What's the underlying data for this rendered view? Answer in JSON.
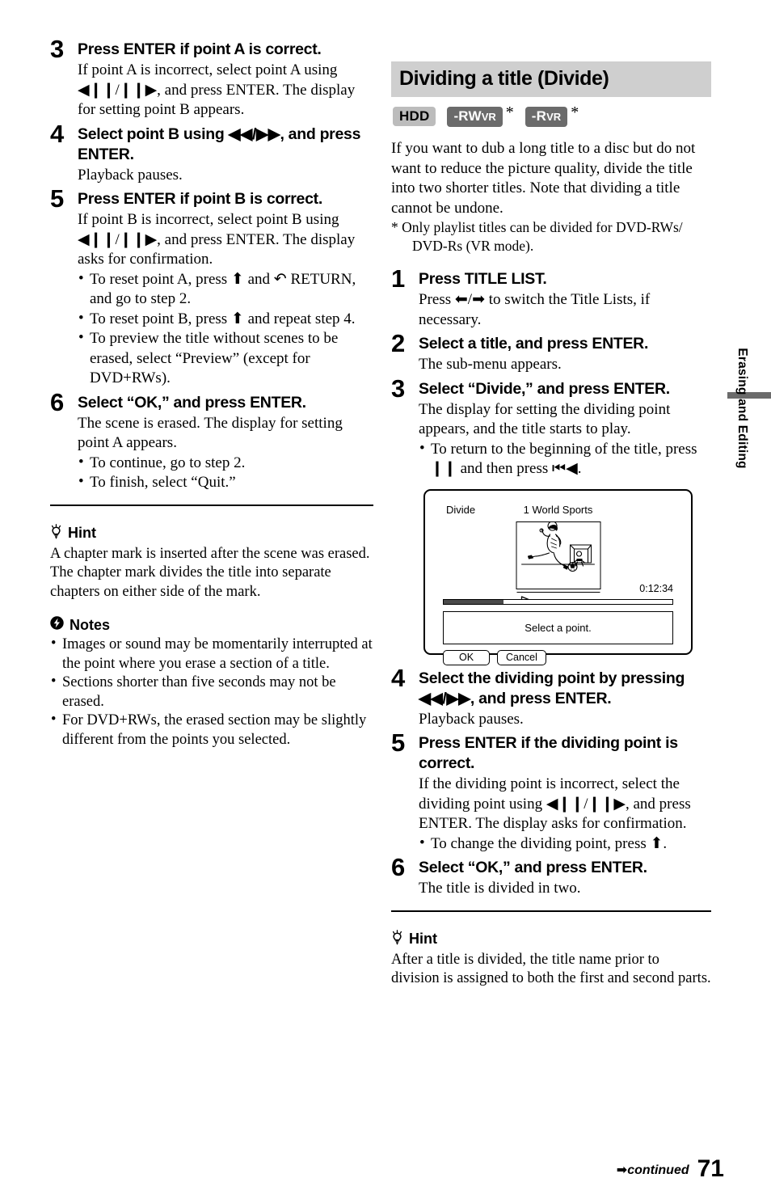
{
  "page": {
    "number": "71",
    "continued_label": "continued",
    "continued_arrow": "➡",
    "side_tab_label": "Erasing and Editing"
  },
  "left_column": {
    "steps": [
      {
        "num": "3",
        "title": "Press ENTER if point A is correct.",
        "text": "If point A is incorrect, select point A using ◀❙❙/❙❙▶, and press ENTER. The display for setting point B appears.",
        "bullets": []
      },
      {
        "num": "4",
        "title": "Select point B using ◀◀/▶▶, and press ENTER.",
        "text": "Playback pauses.",
        "bullets": []
      },
      {
        "num": "5",
        "title": "Press ENTER if point B is correct.",
        "text": "If point B is incorrect, select point B using ◀❙❙/❙❙▶, and press ENTER. The display asks for confirmation.",
        "bullets": [
          "To reset point A, press ⬆ and ↶ RETURN, and go to step 2.",
          "To reset point B, press ⬆ and repeat step 4.",
          "To preview the title without scenes to be erased, select “Preview” (except for DVD+RWs)."
        ]
      },
      {
        "num": "6",
        "title": "Select “OK,” and press ENTER.",
        "text": "The scene is erased. The display for setting point A appears.",
        "bullets": [
          "To continue, go to step 2.",
          "To finish, select “Quit.”"
        ]
      }
    ],
    "hint": {
      "label": "Hint",
      "body": "A chapter mark is inserted after the scene was erased. The chapter mark divides the title into separate chapters on either side of the mark."
    },
    "notes": {
      "label": "Notes",
      "items": [
        "Images or sound may be momentarily interrupted at the point where you erase a section of a title.",
        "Sections shorter than five seconds may not be erased.",
        "For DVD+RWs, the erased section may be slightly different from the points you selected."
      ]
    }
  },
  "right_column": {
    "section_title": "Dividing a title (Divide)",
    "badges": [
      {
        "label": "HDD",
        "style": "hdd",
        "small_suffix": "",
        "star": false
      },
      {
        "label": "-RW",
        "style": "dark",
        "small_suffix": "VR",
        "star": true
      },
      {
        "label": "-R",
        "style": "dark",
        "small_suffix": "VR",
        "star": true
      }
    ],
    "intro": "If you want to dub a long title to a disc but do not want to reduce the picture quality, divide the title into two shorter titles. Note that dividing a title cannot be undone.",
    "footnote_line1": "* Only playlist titles can be divided for DVD-RWs/",
    "footnote_line2": "DVD-Rs (VR mode).",
    "steps_before_figure": [
      {
        "num": "1",
        "title": "Press TITLE LIST.",
        "text": "Press ⬅/➡ to switch the Title Lists, if necessary.",
        "bullets": []
      },
      {
        "num": "2",
        "title": "Select a title, and press ENTER.",
        "text": "The sub-menu appears.",
        "bullets": []
      },
      {
        "num": "3",
        "title": "Select “Divide,” and press ENTER.",
        "text": "The display for setting the dividing point appears, and the title starts to play.",
        "bullets": [
          "To return to the beginning of the title, press ❙❙ and then press ⏮◀."
        ]
      }
    ],
    "figure": {
      "mode_label": "Divide",
      "title_label": "1 World Sports",
      "time": "0:12:34",
      "play_icon": "play-icon",
      "message": "Select a point.",
      "ok_label": "OK",
      "cancel_label": "Cancel",
      "progress_percent": 26
    },
    "steps_after_figure": [
      {
        "num": "4",
        "title": "Select the dividing point by pressing ◀◀/▶▶, and press ENTER.",
        "text": "Playback pauses.",
        "bullets": []
      },
      {
        "num": "5",
        "title": "Press ENTER if the dividing point is correct.",
        "text": "If the dividing point is incorrect, select the dividing point using ◀❙❙/❙❙▶, and press ENTER. The display asks for confirmation.",
        "bullets": [
          "To change the dividing point, press ⬆."
        ]
      },
      {
        "num": "6",
        "title": "Select “OK,” and press ENTER.",
        "text": "The title is divided in two.",
        "bullets": []
      }
    ],
    "hint": {
      "label": "Hint",
      "body": "After a title is divided, the title name prior to division is assigned to both the first and second parts."
    }
  },
  "colors": {
    "section_band": "#cfcfcf",
    "badge_hdd_bg": "#bcbcbc",
    "badge_dark_bg": "#6b6b6b",
    "side_tab_bar": "#6b6b6b",
    "progress_fill": "#4a4a4a"
  }
}
